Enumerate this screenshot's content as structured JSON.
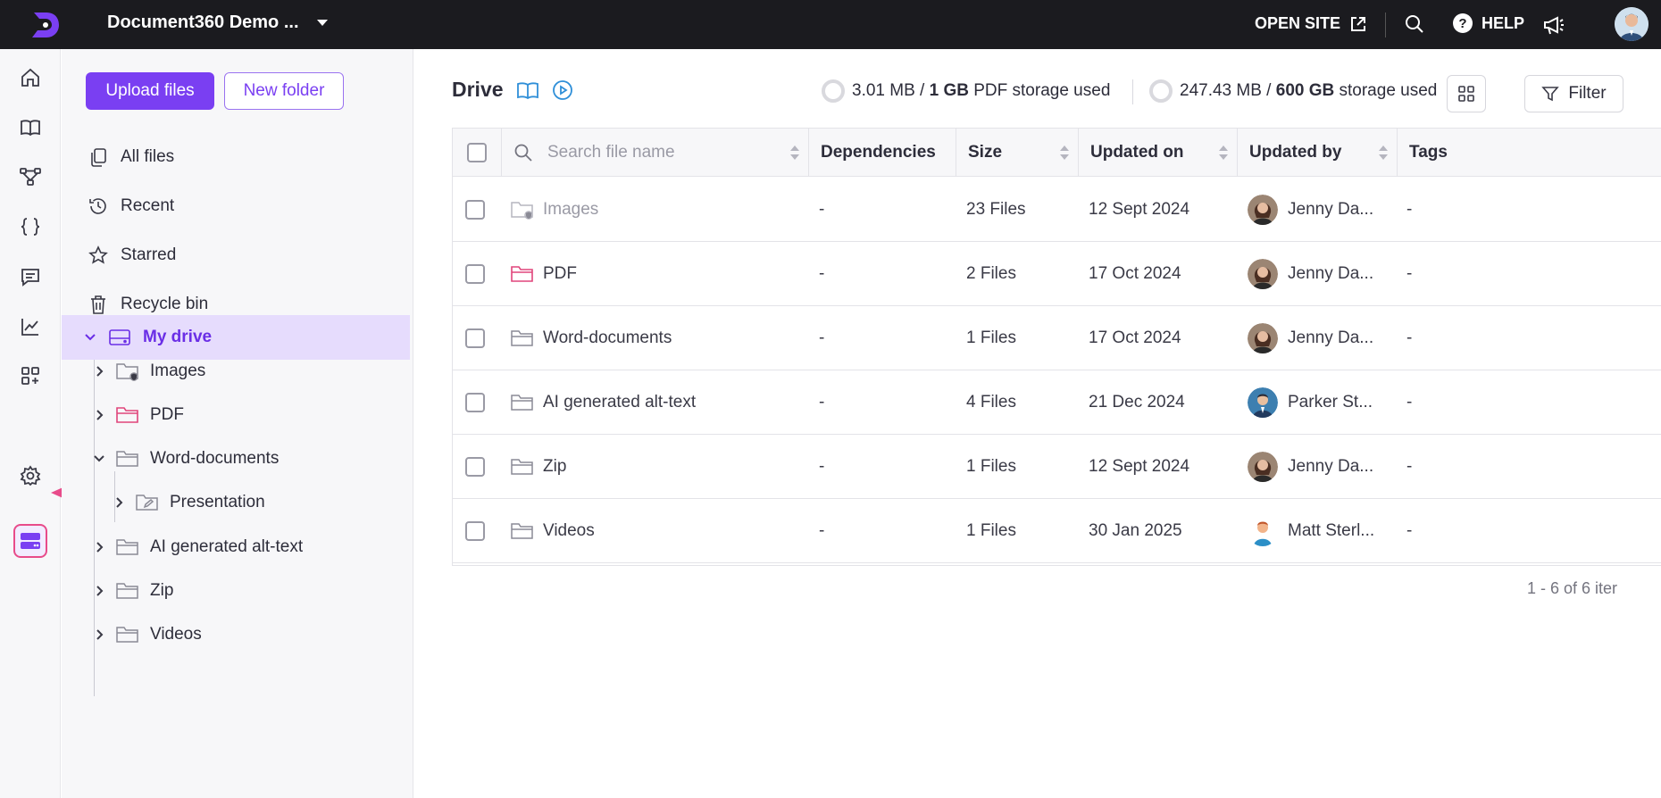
{
  "topbar": {
    "project_name": "Document360 Demo ...",
    "open_site": "OPEN SITE",
    "help": "HELP",
    "help_glyph": "?"
  },
  "rail": {
    "icons": [
      "home-icon",
      "book-icon",
      "workflow-icon",
      "api-braces-icon",
      "feedback-icon",
      "analytics-icon",
      "integrations-icon",
      "drive-icon",
      "settings-icon"
    ],
    "active": "drive-icon"
  },
  "sidebar": {
    "upload_label": "Upload files",
    "new_folder_label": "New folder",
    "nav": [
      {
        "label": "All files",
        "icon": "copy-icon"
      },
      {
        "label": "Recent",
        "icon": "history-icon"
      },
      {
        "label": "Starred",
        "icon": "star-icon"
      },
      {
        "label": "Recycle bin",
        "icon": "trash-icon"
      }
    ],
    "my_drive": "My drive",
    "tree": [
      {
        "label": "Images",
        "expanded": false
      },
      {
        "label": "PDF",
        "expanded": false
      },
      {
        "label": "Word-documents",
        "expanded": true
      },
      {
        "label": "Presentation",
        "expanded": false
      },
      {
        "label": "AI generated alt-text",
        "expanded": false
      },
      {
        "label": "Zip",
        "expanded": false
      },
      {
        "label": "Videos",
        "expanded": false
      }
    ]
  },
  "main": {
    "title": "Drive",
    "pdf_storage": {
      "used": "3.01 MB",
      "sep": " / ",
      "total": "1 GB",
      "suffix": " PDF storage used"
    },
    "storage": {
      "used": "247.43 MB",
      "sep": " / ",
      "total": "600 GB",
      "suffix": " storage used"
    },
    "filter_label": "Filter",
    "search_placeholder": "Search file name",
    "columns": [
      "Dependencies",
      "Size",
      "Updated on",
      "Updated by",
      "Tags"
    ],
    "rows": [
      {
        "name": "Images",
        "deps": "-",
        "size": "23 Files",
        "updated": "12 Sept 2024",
        "by": "Jenny Da...",
        "tags": "-"
      },
      {
        "name": "PDF",
        "deps": "-",
        "size": "2 Files",
        "updated": "17 Oct 2024",
        "by": "Jenny Da...",
        "tags": "-"
      },
      {
        "name": "Word-documents",
        "deps": "-",
        "size": "1 Files",
        "updated": "17 Oct 2024",
        "by": "Jenny Da...",
        "tags": "-"
      },
      {
        "name": "AI generated alt-text",
        "deps": "-",
        "size": "4 Files",
        "updated": "21 Dec 2024",
        "by": "Parker St...",
        "tags": "-"
      },
      {
        "name": "Zip",
        "deps": "-",
        "size": "1 Files",
        "updated": "12 Sept 2024",
        "by": "Jenny Da...",
        "tags": "-"
      },
      {
        "name": "Videos",
        "deps": "-",
        "size": "1 Files",
        "updated": "30 Jan 2025",
        "by": "Matt Sterl...",
        "tags": "-"
      }
    ],
    "pagination": "1 - 6 of 6 iter"
  },
  "colors": {
    "accent": "#7a3ff2",
    "highlight": "#e84b8a",
    "topbar": "#1b1b1f",
    "pdf_folder": "#e0457b"
  }
}
